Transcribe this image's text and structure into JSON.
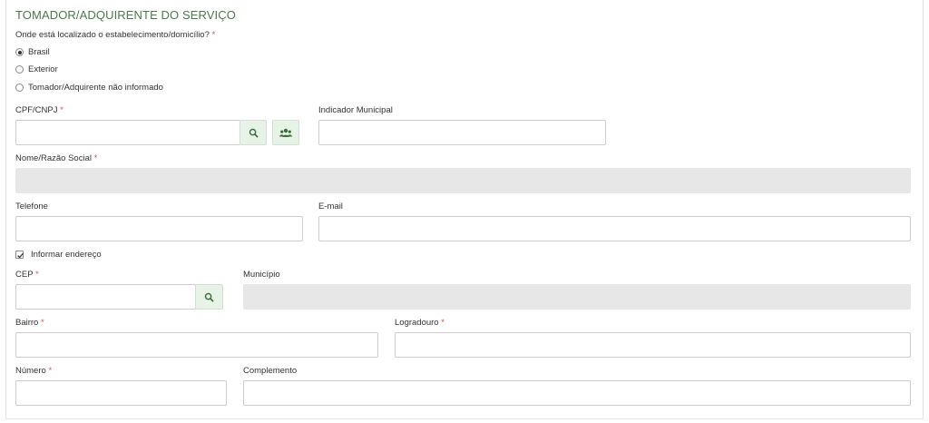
{
  "section": {
    "title": "TOMADOR/ADQUIRENTE DO SERVIÇO"
  },
  "location": {
    "question": "Onde está localizado o estabelecimento/domicílio?",
    "required_mark": "*",
    "options": [
      {
        "label": "Brasil",
        "selected": true
      },
      {
        "label": "Exterior",
        "selected": false
      },
      {
        "label": "Tomador/Adquirente não informado",
        "selected": false
      }
    ]
  },
  "fields": {
    "cpf_cnpj": {
      "label": "CPF/CNPJ",
      "required": "*",
      "value": ""
    },
    "indicador_municipal": {
      "label": "Indicador Municipal",
      "value": ""
    },
    "nome": {
      "label": "Nome/Razão Social",
      "required": "*",
      "value": ""
    },
    "telefone": {
      "label": "Telefone",
      "value": ""
    },
    "email": {
      "label": "E-mail",
      "value": ""
    },
    "cep": {
      "label": "CEP",
      "required": "*",
      "value": ""
    },
    "municipio": {
      "label": "Município",
      "value": ""
    },
    "bairro": {
      "label": "Bairro",
      "required": "*",
      "value": ""
    },
    "logradouro": {
      "label": "Logradouro",
      "required": "*",
      "value": ""
    },
    "numero": {
      "label": "Número",
      "required": "*",
      "value": ""
    },
    "complemento": {
      "label": "Complemento",
      "value": ""
    }
  },
  "address_toggle": {
    "label": "Informar endereço",
    "checked": true
  },
  "icons": {
    "search": "search-icon",
    "users": "users-icon",
    "check": "checkmark-icon"
  },
  "colors": {
    "accent_green": "#4a7a4a",
    "button_bg": "#e8f3e8",
    "required_red": "#d9534f",
    "readonly_bg": "#e7e7e7"
  }
}
